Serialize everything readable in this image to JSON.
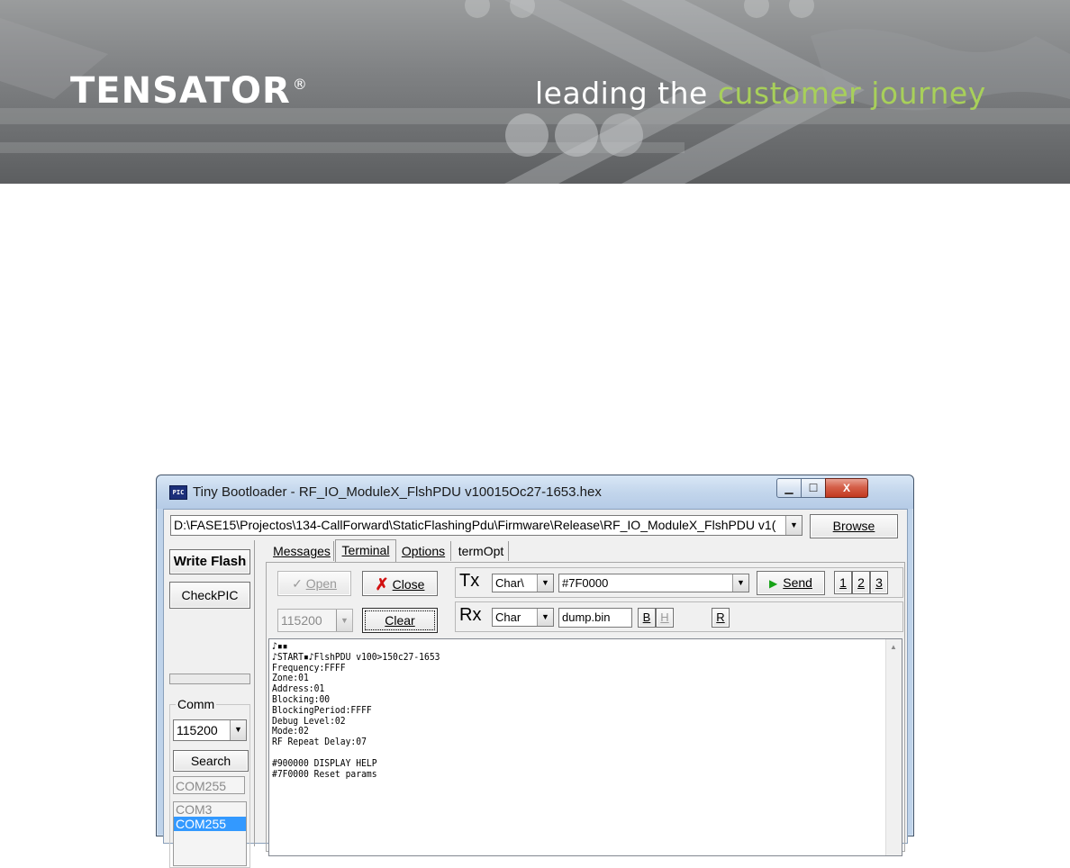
{
  "banner": {
    "logo": "TENSATOR",
    "registered_mark": "®",
    "tagline_part1": "leading the",
    "tagline_part2": "customer journey",
    "accent_color": "#a8d05a"
  },
  "window": {
    "icon_text": "PIC",
    "title": "Tiny Bootloader - RF_IO_ModuleX_FlshPDU v10015Oc27-1653.hex",
    "min_glyph": "▁",
    "max_glyph": "☐",
    "close_glyph": "X",
    "path_value": "D:\\FASE15\\Projectos\\134-CallForward\\StaticFlashingPdu\\Firmware\\Release\\RF_IO_ModuleX_FlshPDU v1(",
    "browse_label": "Browse",
    "dropdown_glyph": "▼"
  },
  "left_panel": {
    "write_flash": "Write Flash",
    "checkpic": "CheckPIC",
    "comm_label": "Comm",
    "baud": "115200",
    "search": "Search",
    "com_field": "COM255",
    "com_list": [
      "COM3",
      "COM255"
    ],
    "selected_com": "COM255"
  },
  "tabs": [
    "Messages",
    "Terminal",
    "Options",
    "termOpt"
  ],
  "active_tab": "Terminal",
  "terminal": {
    "open_label": "Open",
    "close_label": "Close",
    "rate": "115200",
    "clear_label": "Clear",
    "tx_label": "Tx",
    "tx_mode": "Char\\",
    "tx_value": "#7F0000",
    "send_label": "Send",
    "num_buttons": [
      "1",
      "2",
      "3"
    ],
    "rx_label": "Rx",
    "rx_mode": "Char",
    "rx_file": "dump.bin",
    "b_label": "B",
    "h_label": "H",
    "r_label": "R",
    "output": "♪▪▪\n♪START▪♪FlshPDU v100>150c27-1653\nFrequency:FFFF\nZone:01\nAddress:01\nBlocking:00\nBlockingPeriod:FFFF\nDebug Level:02\nMode:02\nRF Repeat Delay:07\n\n#900000 DISPLAY HELP\n#7F0000 Reset params"
  }
}
